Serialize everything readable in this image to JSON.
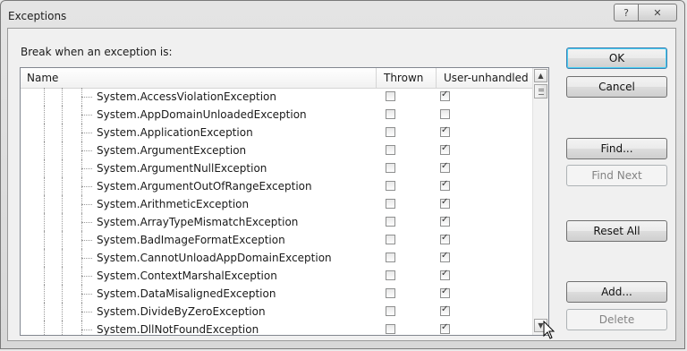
{
  "window": {
    "title": "Exceptions",
    "help_glyph": "?",
    "close_glyph": "✕"
  },
  "prompt": "Break when an exception is:",
  "columns": {
    "name": "Name",
    "thrown": "Thrown",
    "user_unhandled": "User-unhandled"
  },
  "rows": [
    {
      "name": "System.AccessViolationException",
      "thrown": false,
      "user_unhandled": true
    },
    {
      "name": "System.AppDomainUnloadedException",
      "thrown": false,
      "user_unhandled": false
    },
    {
      "name": "System.ApplicationException",
      "thrown": false,
      "user_unhandled": true
    },
    {
      "name": "System.ArgumentException",
      "thrown": false,
      "user_unhandled": true
    },
    {
      "name": "System.ArgumentNullException",
      "thrown": false,
      "user_unhandled": true
    },
    {
      "name": "System.ArgumentOutOfRangeException",
      "thrown": false,
      "user_unhandled": true
    },
    {
      "name": "System.ArithmeticException",
      "thrown": false,
      "user_unhandled": true
    },
    {
      "name": "System.ArrayTypeMismatchException",
      "thrown": false,
      "user_unhandled": true
    },
    {
      "name": "System.BadImageFormatException",
      "thrown": false,
      "user_unhandled": true
    },
    {
      "name": "System.CannotUnloadAppDomainException",
      "thrown": false,
      "user_unhandled": true
    },
    {
      "name": "System.ContextMarshalException",
      "thrown": false,
      "user_unhandled": true
    },
    {
      "name": "System.DataMisalignedException",
      "thrown": false,
      "user_unhandled": true
    },
    {
      "name": "System.DivideByZeroException",
      "thrown": false,
      "user_unhandled": true
    },
    {
      "name": "System.DllNotFoundException",
      "thrown": false,
      "user_unhandled": true
    }
  ],
  "buttons": {
    "ok": "OK",
    "cancel": "Cancel",
    "find": "Find...",
    "find_next": "Find Next",
    "reset_all": "Reset All",
    "add": "Add...",
    "delete": "Delete"
  },
  "icons": {
    "scroll_up": "▲",
    "scroll_down": "▼"
  }
}
